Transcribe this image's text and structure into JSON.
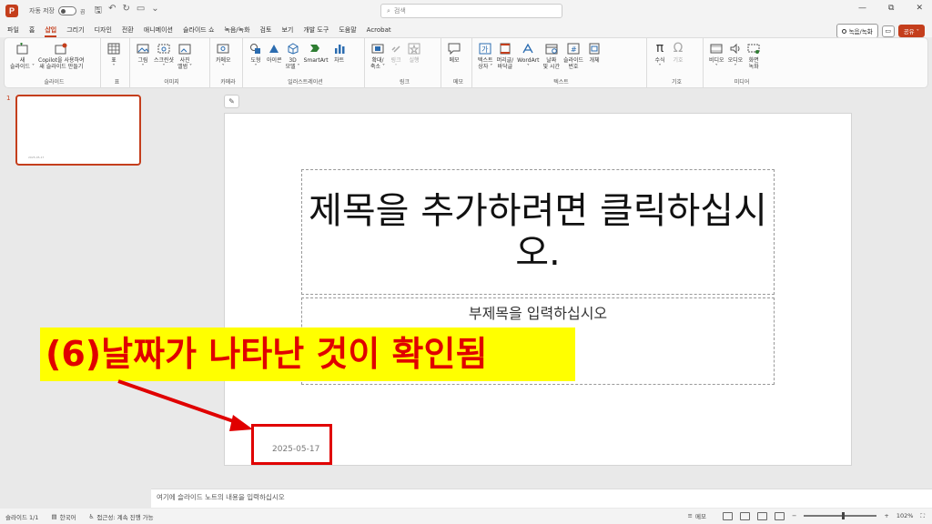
{
  "titlebar": {
    "autosave_label": "자동 저장",
    "autosave_state": "끔",
    "search_placeholder": "검색"
  },
  "menu": {
    "tabs": [
      "파일",
      "홈",
      "삽입",
      "그리기",
      "디자인",
      "전환",
      "애니메이션",
      "슬라이드 쇼",
      "녹음/녹화",
      "검토",
      "보기",
      "개발 도구",
      "도움말",
      "Acrobat"
    ],
    "active_tab": "삽입",
    "record_label": "녹음/녹화",
    "share_label": "공유"
  },
  "ribbon": {
    "groups": [
      {
        "label": "슬라이드",
        "buttons": [
          "새\n슬라이드 ˅",
          "Copilot을 사용하여\n새 슬라이드 만들기"
        ]
      },
      {
        "label": "표",
        "buttons": [
          "표\n˅"
        ]
      },
      {
        "label": "이미지",
        "buttons": [
          "그림\n˅",
          "스크린샷\n˅",
          "사진\n앨범 ˅"
        ]
      },
      {
        "label": "카메라",
        "buttons": [
          "카메오\n˅"
        ]
      },
      {
        "label": "일러스트레이션",
        "buttons": [
          "도형\n˅",
          "아이콘",
          "3D\n모델 ˅",
          "SmartArt",
          "차트"
        ]
      },
      {
        "label": "링크",
        "buttons": [
          "확대/\n축소 ˅",
          "링크\n˅",
          "실행"
        ]
      },
      {
        "label": "메모",
        "buttons": [
          "메모"
        ]
      },
      {
        "label": "텍스트",
        "buttons": [
          "텍스트\n상자 ˅",
          "머리글/\n바닥글",
          "WordArt\n˅",
          "날짜\n및 시간",
          "슬라이드\n번호",
          "개체"
        ]
      },
      {
        "label": "기호",
        "buttons": [
          "수식\n˅",
          "기호"
        ]
      },
      {
        "label": "미디어",
        "buttons": [
          "비디오\n˅",
          "오디오\n˅",
          "화면\n녹화"
        ]
      }
    ]
  },
  "thumbnail": {
    "number": "1",
    "date": "2025-05-17"
  },
  "slide": {
    "title_placeholder": "제목을 추가하려면 클릭하십시오.",
    "subtitle_placeholder": "부제목을 입력하십시오",
    "date_text": "2025-05-17"
  },
  "annotation": {
    "text": "(6)날짜가 나타난 것이 확인됨"
  },
  "notes": {
    "placeholder": "여기에 슬라이드 노트의 내용을 입력하십시오"
  },
  "statusbar": {
    "slide_info": "슬라이드 1/1",
    "language": "한국어",
    "accessibility": "접근성: 계속 진행 가능",
    "notes_label": "메모",
    "zoom": "102%"
  },
  "colors": {
    "accent": "#c43e1c",
    "annotation_red": "#e00000",
    "annotation_yellow": "#ffff00"
  }
}
